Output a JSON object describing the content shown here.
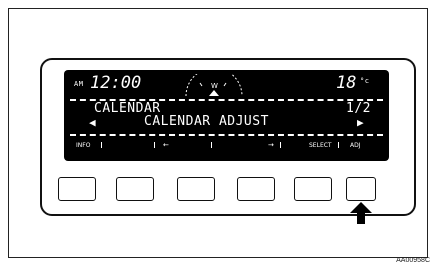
{
  "header": {
    "ampm": "AM",
    "time": "12:00",
    "temperature": "18",
    "temp_unit": "°c"
  },
  "menu": {
    "title": "CALENDAR",
    "page": "1/2",
    "item": "CALENDAR ADJUST",
    "prev_arrow": "◀",
    "next_arrow": "▶"
  },
  "bottom_labels": {
    "info": "INFO",
    "left": "←",
    "right": "→",
    "select": "SELECT",
    "adj": "ADJ"
  },
  "figure_id": "AA00958C"
}
